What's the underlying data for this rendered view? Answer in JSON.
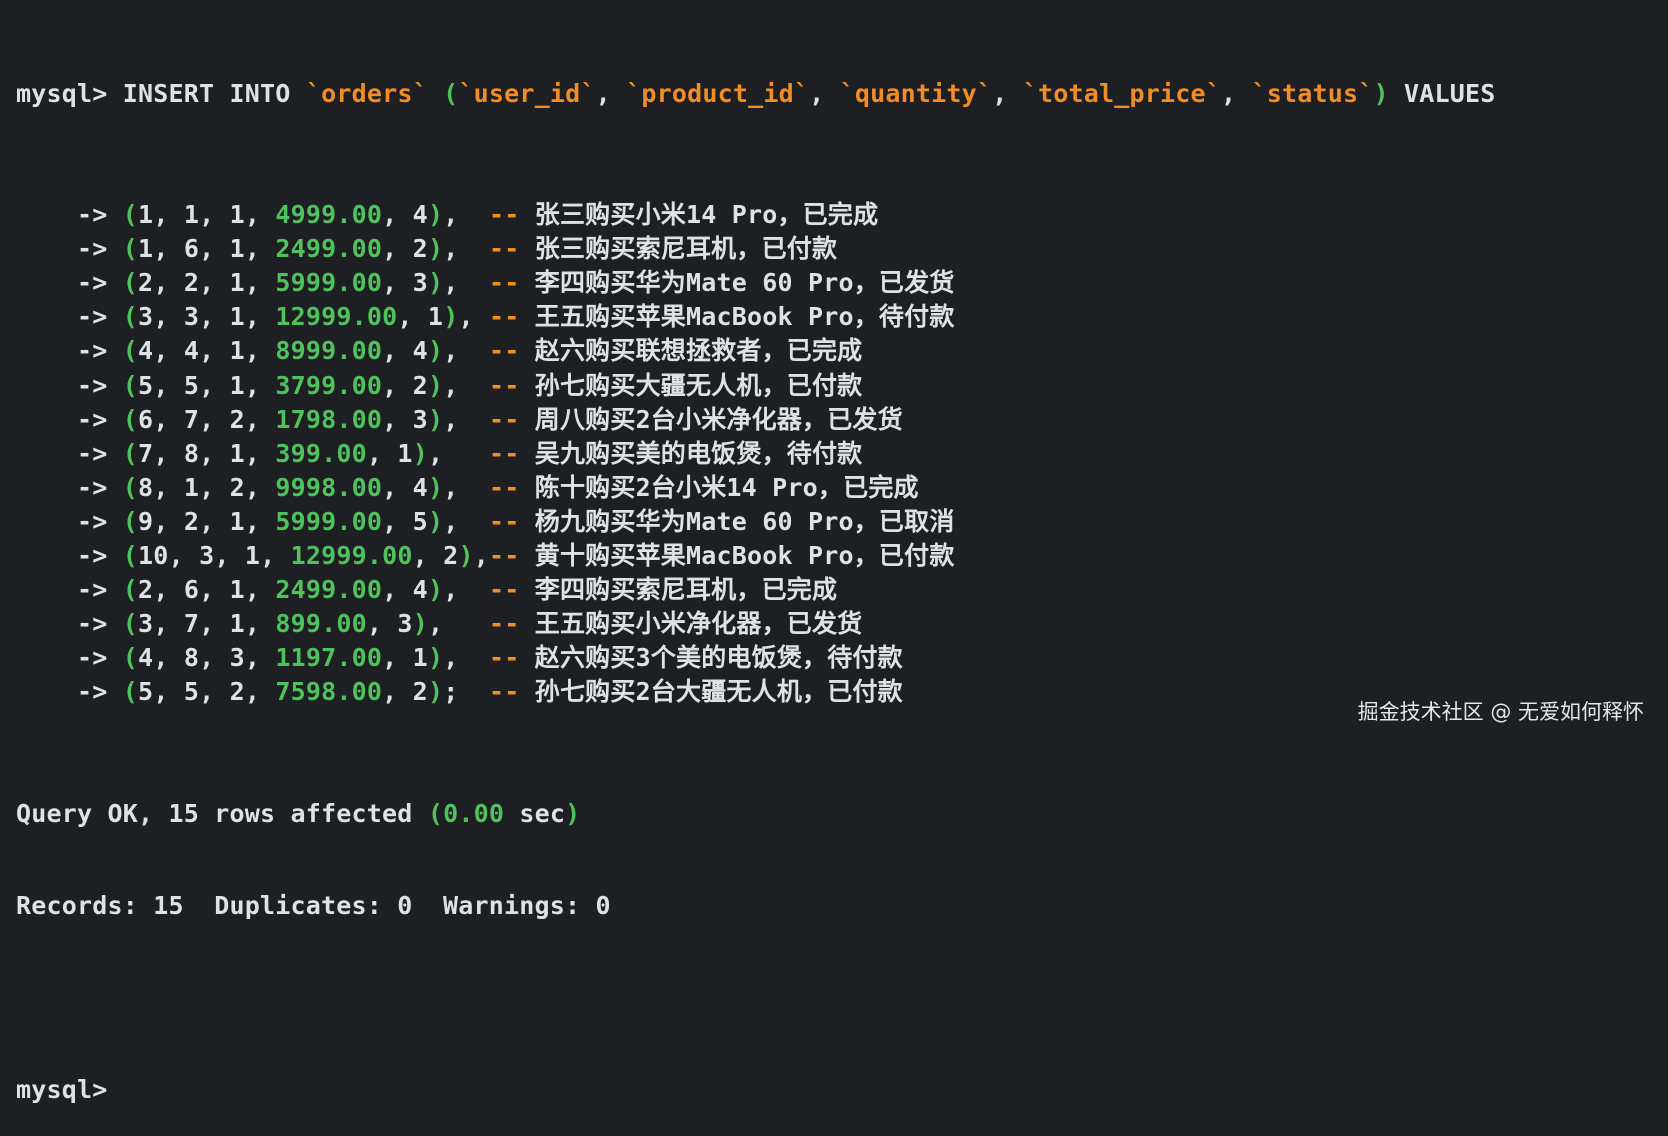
{
  "terminal": {
    "prompt": "mysql>",
    "insert": {
      "keyword": "INSERT INTO",
      "table": "`orders`",
      "open_paren": "(",
      "columns": [
        "`user_id`",
        "`product_id`",
        "`quantity`",
        "`total_price`",
        "`status`"
      ],
      "close_paren": ")",
      "values_keyword": "VALUES"
    },
    "continuation_arrow": "->",
    "rows": [
      {
        "user_id": "1",
        "product_id": "1",
        "quantity": "1",
        "total_price": "4999.00",
        "status": "4",
        "terminator": ",",
        "pad": "  ",
        "comment": "张三购买小米14 Pro，已完成"
      },
      {
        "user_id": "1",
        "product_id": "6",
        "quantity": "1",
        "total_price": "2499.00",
        "status": "2",
        "terminator": ",",
        "pad": "  ",
        "comment": "张三购买索尼耳机，已付款"
      },
      {
        "user_id": "2",
        "product_id": "2",
        "quantity": "1",
        "total_price": "5999.00",
        "status": "3",
        "terminator": ",",
        "pad": "  ",
        "comment": "李四购买华为Mate 60 Pro，已发货"
      },
      {
        "user_id": "3",
        "product_id": "3",
        "quantity": "1",
        "total_price": "12999.00",
        "status": "1",
        "terminator": ",",
        "pad": " ",
        "comment": "王五购买苹果MacBook Pro，待付款"
      },
      {
        "user_id": "4",
        "product_id": "4",
        "quantity": "1",
        "total_price": "8999.00",
        "status": "4",
        "terminator": ",",
        "pad": "  ",
        "comment": "赵六购买联想拯救者，已完成"
      },
      {
        "user_id": "5",
        "product_id": "5",
        "quantity": "1",
        "total_price": "3799.00",
        "status": "2",
        "terminator": ",",
        "pad": "  ",
        "comment": "孙七购买大疆无人机，已付款"
      },
      {
        "user_id": "6",
        "product_id": "7",
        "quantity": "2",
        "total_price": "1798.00",
        "status": "3",
        "terminator": ",",
        "pad": "  ",
        "comment": "周八购买2台小米净化器，已发货"
      },
      {
        "user_id": "7",
        "product_id": "8",
        "quantity": "1",
        "total_price": "399.00",
        "status": "1",
        "terminator": ",",
        "pad": "   ",
        "comment": "吴九购买美的电饭煲，待付款"
      },
      {
        "user_id": "8",
        "product_id": "1",
        "quantity": "2",
        "total_price": "9998.00",
        "status": "4",
        "terminator": ",",
        "pad": "  ",
        "comment": "陈十购买2台小米14 Pro，已完成"
      },
      {
        "user_id": "9",
        "product_id": "2",
        "quantity": "1",
        "total_price": "5999.00",
        "status": "5",
        "terminator": ",",
        "pad": "  ",
        "comment": "杨九购买华为Mate 60 Pro，已取消"
      },
      {
        "user_id": "10",
        "product_id": "3",
        "quantity": "1",
        "total_price": "12999.00",
        "status": "2",
        "terminator": ",",
        "pad": "",
        "comment": "黄十购买苹果MacBook Pro，已付款"
      },
      {
        "user_id": "2",
        "product_id": "6",
        "quantity": "1",
        "total_price": "2499.00",
        "status": "4",
        "terminator": ",",
        "pad": "  ",
        "comment": "李四购买索尼耳机，已完成"
      },
      {
        "user_id": "3",
        "product_id": "7",
        "quantity": "1",
        "total_price": "899.00",
        "status": "3",
        "terminator": ",",
        "pad": "   ",
        "comment": "王五购买小米净化器，已发货"
      },
      {
        "user_id": "4",
        "product_id": "8",
        "quantity": "3",
        "total_price": "1197.00",
        "status": "1",
        "terminator": ",",
        "pad": "  ",
        "comment": "赵六购买3个美的电饭煲，待付款"
      },
      {
        "user_id": "5",
        "product_id": "5",
        "quantity": "2",
        "total_price": "7598.00",
        "status": "2",
        "terminator": ";",
        "pad": "  ",
        "comment": "孙七购买2台大疆无人机，已付款"
      }
    ],
    "comment_prefix": "--",
    "result": {
      "query_ok": "Query OK, 15 rows affected",
      "time_open": "(",
      "time": "0.00",
      "time_unit": " sec",
      "time_close": ")",
      "records_line": "Records: 15  Duplicates: 0  Warnings: 0"
    },
    "final_prompt": "mysql>"
  },
  "watermark": "掘金技术社区 @ 无爱如何释怀",
  "colors": {
    "background": "#1e1f22",
    "text": "#dfe1e5",
    "string_orange": "#f08d29",
    "number_green": "#50c25d"
  }
}
